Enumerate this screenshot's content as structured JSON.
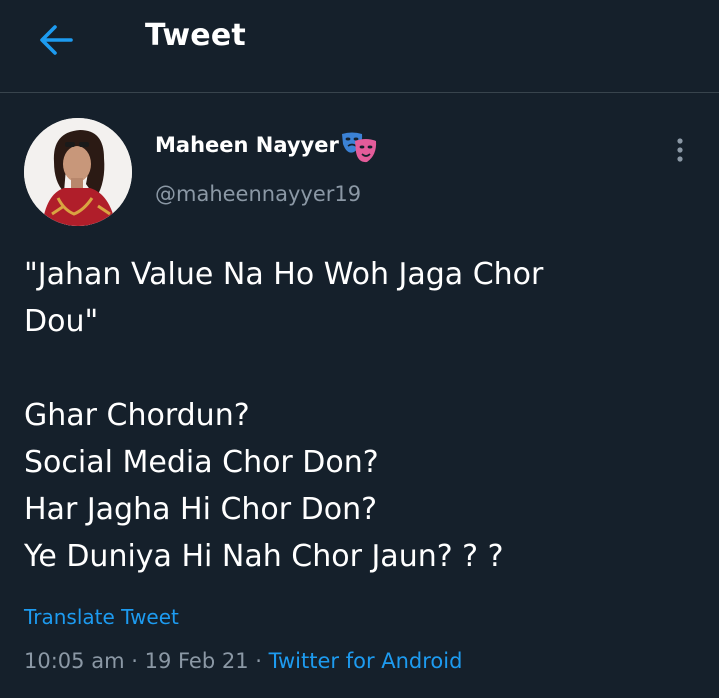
{
  "header": {
    "title": "Tweet",
    "back_icon": "arrow-left-icon"
  },
  "author": {
    "name": "Maheen Nayyer",
    "badge_icon": "performing-arts-masks-icon",
    "handle": "@maheennayyer19"
  },
  "tweet": {
    "lines": [
      "\"Jahan Value Na Ho Woh Jaga Chor",
      "Dou\"",
      "",
      "Ghar Chordun?",
      "Social Media Chor Don?",
      "Har Jagha Hi Chor Don?",
      "Ye Duniya Hi Nah Chor Jaun? ? ?"
    ],
    "translate_label": "Translate Tweet",
    "time": "10:05 am",
    "date": "19 Feb 21",
    "separator": "·",
    "source": "Twitter for Android"
  },
  "colors": {
    "background": "#15202b",
    "accent": "#1d9bf0",
    "secondary_text": "#8b98a5",
    "divider": "#38444d"
  }
}
